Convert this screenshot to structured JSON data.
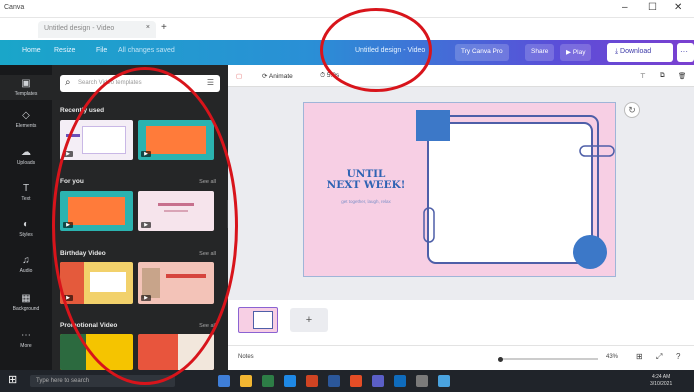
{
  "window": {
    "app_label": "Canva"
  },
  "browser": {
    "tab_title": "Untitled design - Video",
    "new_tab": "+",
    "close": "×"
  },
  "topbar": {
    "home": "Home",
    "resize": "Resize",
    "file": "File",
    "saved_status": "All changes saved",
    "doc_title": "Untitled design - Video",
    "subscription": "Try Canva Pro",
    "share": "Share",
    "play": "Play",
    "download": "Download",
    "more": "···"
  },
  "rail": {
    "items": [
      {
        "label": "Templates",
        "icon": "templates-icon"
      },
      {
        "label": "Elements",
        "icon": "elements-icon"
      },
      {
        "label": "Uploads",
        "icon": "uploads-icon"
      },
      {
        "label": "Text",
        "icon": "text-icon"
      },
      {
        "label": "Styles",
        "icon": "styles-icon"
      },
      {
        "label": "Audio",
        "icon": "audio-icon"
      },
      {
        "label": "Background",
        "icon": "background-icon"
      },
      {
        "label": "More",
        "icon": "more-icon"
      }
    ]
  },
  "panel": {
    "search_placeholder": "Search Video templates",
    "sections": [
      {
        "title": "Recently used",
        "see_all": ""
      },
      {
        "title": "For you",
        "see_all": "See all"
      },
      {
        "title": "Birthday Video",
        "see_all": "See all"
      },
      {
        "title": "Promotional Video",
        "see_all": "See all"
      }
    ]
  },
  "editor": {
    "toolbar": {
      "animate": "Animate",
      "duration": "5.0s"
    },
    "design": {
      "headline": "UNTIL\nNEXT WEEK!",
      "subline": "get together, laugh, relax"
    },
    "add_page": "+"
  },
  "footer": {
    "notes": "Notes",
    "zoom": "43%"
  },
  "taskbar": {
    "search": "Type here to search",
    "time": "4:24 AM",
    "date": "3/10/2021"
  },
  "colors": {
    "topbar_start": "#1aa6c9",
    "topbar_end": "#7a3fd0",
    "panel_bg": "#252627",
    "design_bg": "#f7cfe4",
    "accent_blue": "#2f63b3",
    "annotation": "#d8141b"
  }
}
